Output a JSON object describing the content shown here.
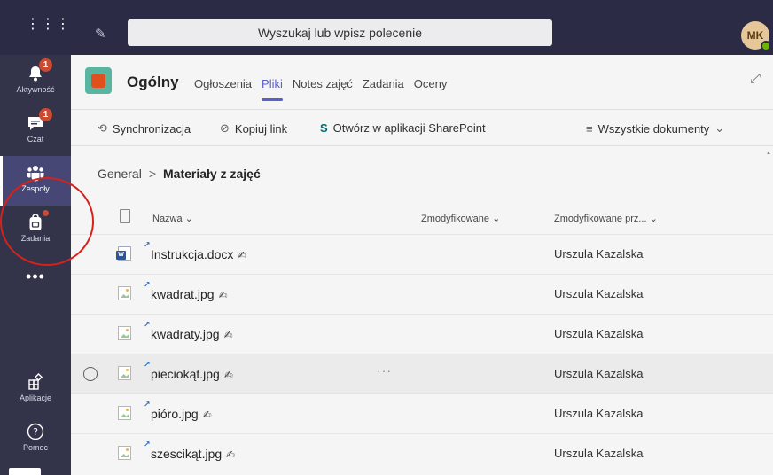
{
  "topbar": {
    "search_placeholder": "Wyszukaj lub wpisz polecenie",
    "avatar_initials": "MK",
    "waffle_icon": "app-launcher-icon",
    "compose_icon": "compose-icon"
  },
  "rail": {
    "items": [
      {
        "label": "Aktywność",
        "icon": "bell-icon",
        "badge": "1"
      },
      {
        "label": "Czat",
        "icon": "chat-icon",
        "badge": "1"
      },
      {
        "label": "Zespoły",
        "icon": "teams-icon",
        "active": true
      },
      {
        "label": "Zadania",
        "icon": "backpack-icon",
        "dot": true
      },
      {
        "label": "Aplikacje",
        "icon": "apps-icon"
      },
      {
        "label": "Pomoc",
        "icon": "help-icon"
      }
    ],
    "more": "•••"
  },
  "channel": {
    "title": "Ogólny",
    "tabs": [
      {
        "label": "Ogłoszenia"
      },
      {
        "label": "Pliki",
        "active": true
      },
      {
        "label": "Notes zajęć"
      },
      {
        "label": "Zadania"
      },
      {
        "label": "Oceny"
      }
    ]
  },
  "toolbar": {
    "sync": "Synchronizacja",
    "copy_link": "Kopiuj link",
    "open_sharepoint": "Otwórz w aplikacji SharePoint",
    "view": "Wszystkie dokumenty"
  },
  "breadcrumb": {
    "root": "General",
    "separator": ">",
    "current": "Materiały z zajęć"
  },
  "files": {
    "columns": {
      "name": "Nazwa",
      "modified": "Zmodyfikowane",
      "modified_by": "Zmodyfikowane prz..."
    },
    "rows": [
      {
        "name": "Instrukcja.docx",
        "type": "word",
        "modified_by": "Urszula Kazalska"
      },
      {
        "name": "kwadrat.jpg",
        "type": "image",
        "modified_by": "Urszula Kazalska"
      },
      {
        "name": "kwadraty.jpg",
        "type": "image",
        "modified_by": "Urszula Kazalska"
      },
      {
        "name": "pieciokąt.jpg",
        "type": "image",
        "modified_by": "Urszula Kazalska",
        "hover": true
      },
      {
        "name": "pióro.jpg",
        "type": "image",
        "modified_by": "Urszula Kazalska"
      },
      {
        "name": "szescikąt.jpg",
        "type": "image",
        "modified_by": "Urszula Kazalska"
      }
    ],
    "row_more": "···"
  },
  "colors": {
    "rail_bg": "#33344a",
    "topbar_bg": "#2b2b45",
    "accent": "#5b5fc7",
    "badge": "#cc4a31",
    "annotation": "#d7211a"
  }
}
